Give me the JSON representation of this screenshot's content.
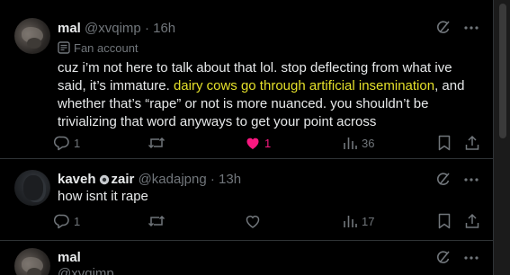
{
  "tweets": [
    {
      "name": "mal",
      "handle": "@xvqimp",
      "separator": "·",
      "time": "16h",
      "label": "Fan account",
      "text_before_link": "cuz i’m not here to talk about that lol. stop deflecting from what ive said, it’s immature. ",
      "link_text": "dairy cows go through artificial insemination",
      "text_after_link": ", and whether that’s “rape” or not is more nuanced. you shouldn’t be trivializing that word anyways to get your point across",
      "replies": "1",
      "retweets": "",
      "likes": "1",
      "liked": true,
      "views": "36"
    },
    {
      "name": "kaveh",
      "name_suffix": "zair",
      "handle": "@kadajpng",
      "separator": "·",
      "time": "13h",
      "text": "how isnt it rape",
      "replies": "1",
      "retweets": "",
      "likes": "",
      "views": "17"
    },
    {
      "name": "mal",
      "handle": "@xvqimp"
    }
  ],
  "colors": {
    "background": "#000000",
    "text": "#e7e9ea",
    "secondary": "#71767b",
    "like_active": "#f91880",
    "highlight_link": "#e4e02a",
    "divider": "#2f3336"
  },
  "icons": {
    "label": "fan-account-badge-icon",
    "grok": "grok-icon",
    "more": "more-icon",
    "reply": "reply-icon",
    "retweet": "retweet-icon",
    "like": "heart-icon",
    "views": "views-icon",
    "bookmark": "bookmark-icon",
    "share": "share-icon",
    "kaveh_badge": "bullet-badge-icon"
  }
}
